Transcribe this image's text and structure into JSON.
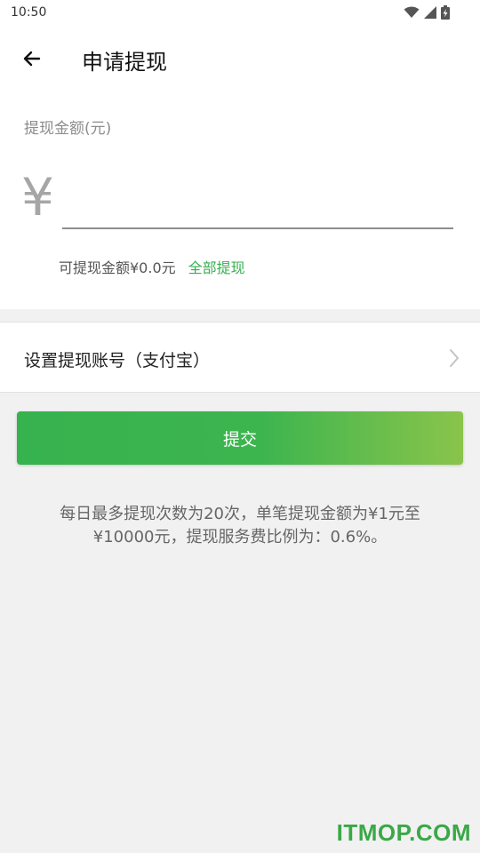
{
  "status_bar": {
    "time": "10:50",
    "icons": [
      "wifi-icon",
      "signal-icon",
      "battery-charging-icon"
    ]
  },
  "header": {
    "back_icon": "arrow-left-icon",
    "title": "申请提现"
  },
  "amount": {
    "label": "提现金额(元)",
    "currency_symbol": "¥",
    "input_value": "",
    "available_text": "可提现金额¥0.0元",
    "withdraw_all_label": "全部提现"
  },
  "account": {
    "label": "设置提现账号（支付宝）",
    "chevron_icon": "chevron-right-icon"
  },
  "submit": {
    "label": "提交"
  },
  "notice": {
    "text": "每日最多提现次数为20次，单笔提现金额为¥1元至¥10000元，提现服务费比例为：0.6%。"
  },
  "watermark": {
    "text": "ITMOP.COM"
  },
  "colors": {
    "accent": "#35b04f",
    "gradient_end": "#8ac44b",
    "background": "#f1f1f1"
  }
}
